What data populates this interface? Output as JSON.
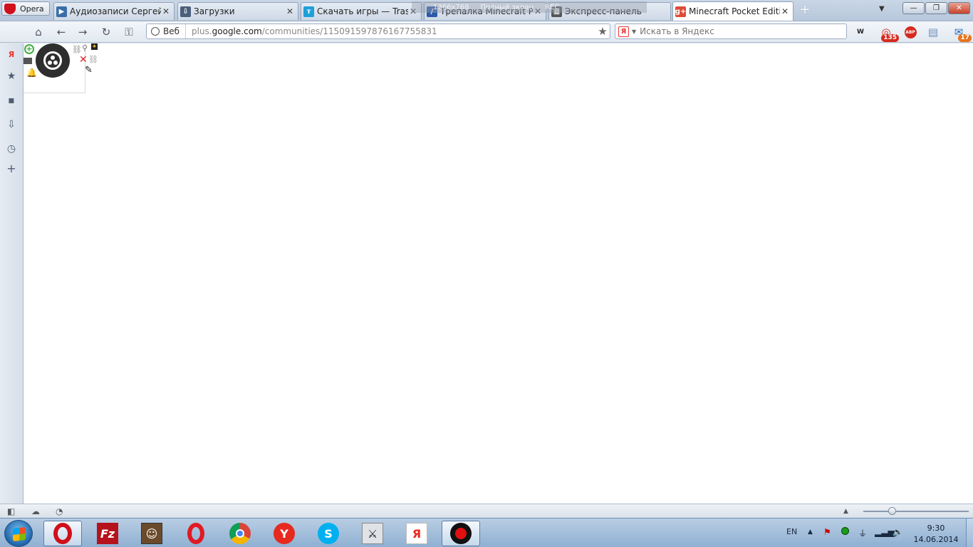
{
  "browser": {
    "menu_label": "Opera",
    "tabs": [
      {
        "label": "Аудиозаписи Сергей ...",
        "icon": "vk-audio-icon",
        "color": "#3b6ea8"
      },
      {
        "label": "Загрузки",
        "icon": "downloads-icon",
        "color": "#4a5f7a"
      },
      {
        "label": "Скачать игры — Trash...",
        "icon": "trashbox-icon",
        "color": "#1e9fd8"
      },
      {
        "label": "Трепалка Minecraft Po...",
        "icon": "forum-icon",
        "color": "#2b5aa6"
      },
      {
        "label": "Экспресс-панель",
        "icon": "speed-dial-icon",
        "color": "#555555"
      },
      {
        "label": "Minecraft Pocket Editio...",
        "icon": "google-plus-icon",
        "color": "#dd4b39"
      }
    ],
    "active_tab": 5,
    "close_glyph": "✕",
    "new_tab_glyph": "+"
  },
  "recorder_overlay": {
    "resolution": "1366x768",
    "mode": "Полный экран",
    "rec_label": "REC"
  },
  "address": {
    "web_badge": "Веб",
    "url_prefix": "plus.",
    "url_domain": "google.com",
    "url_path": "/communities/115091597876167755831"
  },
  "search": {
    "engine_letter": "Я",
    "placeholder": "Искать в Яндекс"
  },
  "extensions": {
    "mail_counter": "135",
    "adblock_label": "ABP",
    "mail2_counter": "17"
  },
  "taskbar": {
    "language": "EN",
    "time": "9:30",
    "date": "14.06.2014"
  },
  "colors": {
    "opera_red": "#d0101b",
    "accent_blue": "#3b6ea8",
    "widget_green": "#3fae3f",
    "widget_red": "#e02020"
  }
}
